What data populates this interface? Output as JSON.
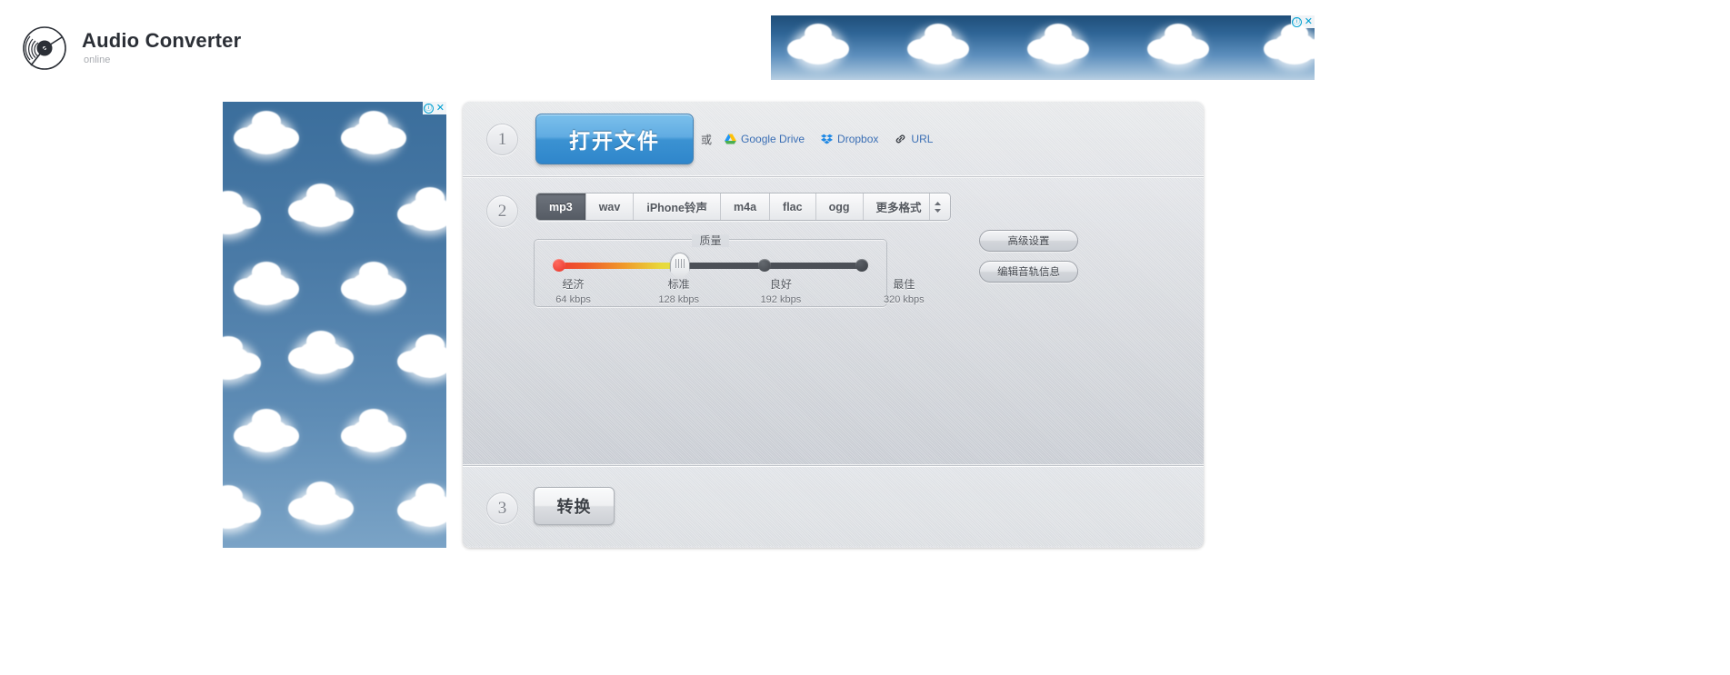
{
  "header": {
    "logo_icon": "vinyl-record-icon",
    "title": "Audio Converter",
    "subtitle": "online"
  },
  "ads": {
    "adchoices_info": "ⓘ",
    "adchoices_close": "✕",
    "top_banner": {
      "name": "top-banner-ad",
      "theme": "clouds-blue-sky"
    },
    "side_banner": {
      "name": "side-skyscraper-ad",
      "theme": "clouds-blue-sky"
    }
  },
  "converter": {
    "step1": {
      "badge": "1",
      "open_file_label": "打开文件",
      "or_label": "或",
      "sources": [
        {
          "label": "Google Drive",
          "icon": "google-drive-icon"
        },
        {
          "label": "Dropbox",
          "icon": "dropbox-icon"
        },
        {
          "label": "URL",
          "icon": "link-icon"
        }
      ]
    },
    "step2": {
      "badge": "2",
      "formats": [
        {
          "label": "mp3",
          "active": true
        },
        {
          "label": "wav",
          "active": false
        },
        {
          "label": "iPhone铃声",
          "active": false
        },
        {
          "label": "m4a",
          "active": false
        },
        {
          "label": "flac",
          "active": false
        },
        {
          "label": "ogg",
          "active": false
        },
        {
          "label": "更多格式",
          "active": false
        }
      ],
      "quality": {
        "title": "质量",
        "selected_index": 1,
        "ticks": [
          {
            "name": "经济",
            "rate": "64 kbps"
          },
          {
            "name": "标准",
            "rate": "128 kbps"
          },
          {
            "name": "良好",
            "rate": "192 kbps"
          },
          {
            "name": "最佳",
            "rate": "320 kbps"
          }
        ]
      },
      "side_buttons": [
        {
          "label": "高级设置"
        },
        {
          "label": "编辑音轨信息"
        }
      ]
    },
    "step3": {
      "badge": "3",
      "convert_label": "转换"
    }
  },
  "colors": {
    "accent_blue": "#3b92d2",
    "link_blue": "#3b6fb5",
    "panel_gray": "#d9dce1",
    "active_tab": "#555b64",
    "quality_low": "#ef3d32",
    "quality_mid": "#e2e04a",
    "track_dark": "#4c5057"
  }
}
